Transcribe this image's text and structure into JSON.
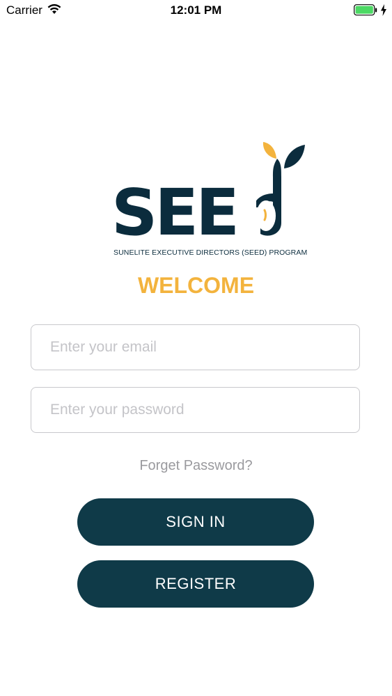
{
  "status_bar": {
    "carrier": "Carrier",
    "time": "12:01 PM",
    "wifi_icon": "wifi-icon",
    "battery_icon": "battery-full-icon",
    "charging_icon": "lightning-bolt-icon"
  },
  "logo": {
    "word": "SEE",
    "subtitle": "SUNELITE EXECUTIVE DIRECTORS (SEED) PROGRAM",
    "icon": "seed-sprout-logo",
    "colors": {
      "navy": "#0b2c3d",
      "gold": "#f3b33d"
    }
  },
  "welcome": "WELCOME",
  "form": {
    "email_placeholder": "Enter your email",
    "email_value": "",
    "password_placeholder": "Enter your password",
    "password_value": ""
  },
  "forgot_password": "Forget Password?",
  "buttons": {
    "sign_in": "SIGN IN",
    "register": "REGISTER",
    "color": "#0f3a48"
  }
}
